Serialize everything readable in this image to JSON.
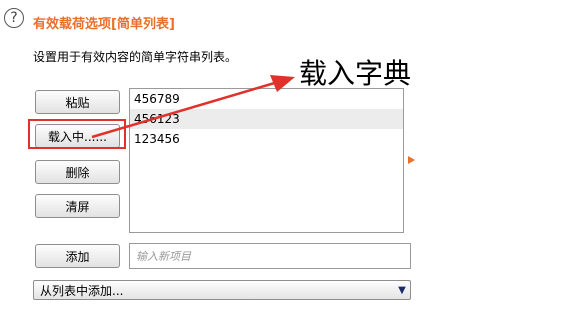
{
  "header": {
    "help_icon_glyph": "?",
    "title": "有效载荷选项[简单列表]",
    "description": "设置用于有效内容的简单字符串列表。"
  },
  "buttons": {
    "paste": "粘贴",
    "load": "载入中......",
    "remove": "删除",
    "clear": "清屏",
    "add": "添加"
  },
  "list": {
    "items": [
      "456789",
      "456123",
      "123456"
    ]
  },
  "new_item": {
    "placeholder": "输入新项目",
    "value": ""
  },
  "add_from_list": {
    "selected": "从列表中添加..."
  },
  "annotation": {
    "text": "载入字典",
    "color": "#e0322b"
  },
  "colors": {
    "accent": "#e8702a",
    "highlight": "#e0322b"
  }
}
